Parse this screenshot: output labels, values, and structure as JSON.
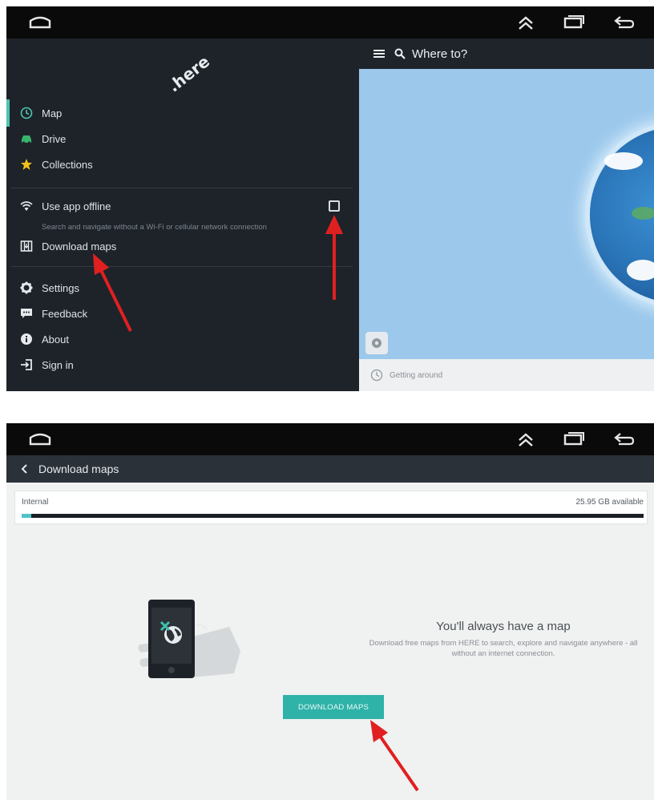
{
  "screen1": {
    "logo": ".here",
    "menu": {
      "map": "Map",
      "drive": "Drive",
      "collections": "Collections",
      "use_offline": "Use app offline",
      "offline_sub": "Search and navigate without a Wi-Fi or cellular network connection",
      "download_maps": "Download maps",
      "settings": "Settings",
      "feedback": "Feedback",
      "about": "About",
      "sign_in": "Sign in"
    },
    "search_placeholder": "Where to?",
    "getting_around": "Getting around"
  },
  "screen2": {
    "title": "Download maps",
    "storage_label": "Internal",
    "storage_available": "25.95 GB available",
    "storage_used_fraction": 0.015,
    "message_title": "You'll always have a map",
    "message_body": "Download free maps from HERE to search, explore and navigate anywhere - all without an internet connection.",
    "button_label": "DOWNLOAD MAPS"
  },
  "icons": {
    "system": [
      "home-icon",
      "chevron-up-icon",
      "recent-apps-icon",
      "back-icon"
    ],
    "menu": [
      "clock-icon",
      "car-icon",
      "star-icon",
      "wifi-icon",
      "map-download-icon",
      "gear-icon",
      "feedback-icon",
      "info-icon",
      "sign-in-icon"
    ]
  },
  "colors": {
    "accent": "#4fc3b0",
    "button": "#2fb2a8",
    "annotation_arrow": "#e02020",
    "drawer_bg": "#1e232a",
    "map_bg": "#9cc8ec"
  }
}
